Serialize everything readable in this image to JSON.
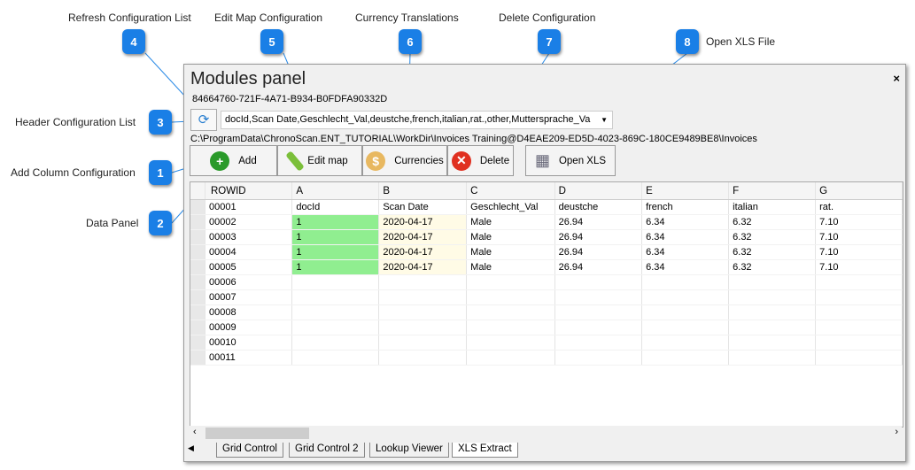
{
  "callouts": [
    {
      "num": "1",
      "label": "Add Column Configuration"
    },
    {
      "num": "2",
      "label": "Data Panel"
    },
    {
      "num": "3",
      "label": "Header Configuration List"
    },
    {
      "num": "4",
      "label": "Refresh Configuration List"
    },
    {
      "num": "5",
      "label": "Edit Map Configuration"
    },
    {
      "num": "6",
      "label": "Currency Translations"
    },
    {
      "num": "7",
      "label": "Delete Configuration"
    },
    {
      "num": "8",
      "label": "Open XLS File"
    }
  ],
  "window": {
    "title": "Modules panel",
    "close": "×"
  },
  "guid": "84664760-721F-4A71-B934-B0FDFA90332D",
  "combo_value": "docId,Scan Date,Geschlecht_Val,deustche,french,italian,rat.,other,Muttersprache_Va",
  "path": "C:\\ProgramData\\ChronoScan.ENT_TUTORIAL\\WorkDir\\Invoices Training@D4EAE209-ED5D-4023-869C-180CE9489BE8\\Invoices",
  "buttons": {
    "add": "Add",
    "edit_map": "Edit map",
    "currencies": "Currencies",
    "delete": "Delete",
    "open_xls": "Open XLS"
  },
  "grid": {
    "headers": [
      "ROWID",
      "A",
      "B",
      "C",
      "D",
      "E",
      "F",
      "G"
    ],
    "rows": [
      [
        "00001",
        "docId",
        "Scan Date",
        "Geschlecht_Val",
        "deustche",
        "french",
        "italian",
        "rat."
      ],
      [
        "00002",
        "1",
        "2020-04-17",
        "Male",
        "26.94",
        "6.34",
        "6.32",
        "7.10"
      ],
      [
        "00003",
        "1",
        "2020-04-17",
        "Male",
        "26.94",
        "6.34",
        "6.32",
        "7.10"
      ],
      [
        "00004",
        "1",
        "2020-04-17",
        "Male",
        "26.94",
        "6.34",
        "6.32",
        "7.10"
      ],
      [
        "00005",
        "1",
        "2020-04-17",
        "Male",
        "26.94",
        "6.34",
        "6.32",
        "7.10"
      ],
      [
        "00006",
        "",
        "",
        "",
        "",
        "",
        "",
        ""
      ],
      [
        "00007",
        "",
        "",
        "",
        "",
        "",
        "",
        ""
      ],
      [
        "00008",
        "",
        "",
        "",
        "",
        "",
        "",
        ""
      ],
      [
        "00009",
        "",
        "",
        "",
        "",
        "",
        "",
        ""
      ],
      [
        "00010",
        "",
        "",
        "",
        "",
        "",
        "",
        ""
      ],
      [
        "00011",
        "",
        "",
        "",
        "",
        "",
        "",
        ""
      ]
    ]
  },
  "tabs": [
    "Grid Control",
    "Grid Control 2",
    "Lookup Viewer",
    "XLS Extract"
  ],
  "active_tab": "XLS Extract",
  "colors": {
    "callout": "#1a7fe6",
    "highlight_green": "#90ee90",
    "highlight_yellow": "#fffbe6"
  }
}
